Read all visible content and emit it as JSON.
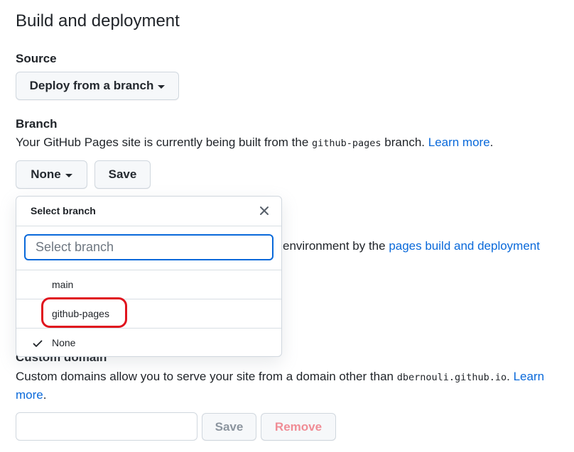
{
  "section": {
    "heading": "Build and deployment"
  },
  "source": {
    "label": "Source",
    "button_label": "Deploy from a branch"
  },
  "branch": {
    "label": "Branch",
    "desc_prefix": "Your GitHub Pages site is currently being built from the ",
    "desc_code": "github-pages",
    "desc_suffix": " branch. ",
    "learn_more": "Learn more",
    "period": ".",
    "selector_label": "None",
    "save_label": "Save"
  },
  "background": {
    "partial_text": "environment by the ",
    "partial_link": "pages build and deployment"
  },
  "custom_domain": {
    "label": "Custom domain",
    "desc_prefix": "Custom domains allow you to serve your site from a domain other than ",
    "desc_code": "dbernouli.github.io",
    "desc_suffix": ". ",
    "learn_more_1": "Learn",
    "learn_more_2": "more",
    "period": ".",
    "input_value": "",
    "save_label": "Save",
    "remove_label": "Remove"
  },
  "dropdown": {
    "title": "Select branch",
    "filter_placeholder": "Select branch",
    "items": [
      {
        "label": "main",
        "selected": false
      },
      {
        "label": "github-pages",
        "selected": false
      },
      {
        "label": "None",
        "selected": true
      }
    ]
  },
  "colors": {
    "link": "#0969da",
    "focus": "#0969da",
    "highlight": "#e0141e"
  }
}
